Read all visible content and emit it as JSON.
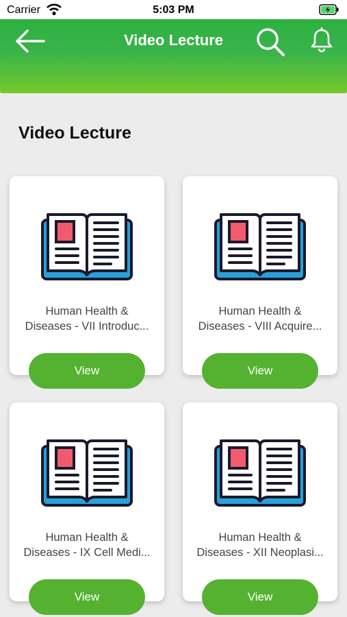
{
  "status_bar": {
    "carrier": "Carrier",
    "time": "5:03 PM"
  },
  "header": {
    "title": "Video Lecture"
  },
  "section": {
    "title": "Video Lecture"
  },
  "cards": [
    {
      "title_line1": "Human Health &",
      "title_line2": "Diseases - VII Introduc...",
      "button_label": "View"
    },
    {
      "title_line1": "Human Health &",
      "title_line2": "Diseases - VIII Acquire...",
      "button_label": "View"
    },
    {
      "title_line1": "Human Health &",
      "title_line2": "Diseases - IX Cell Medi...",
      "button_label": "View"
    },
    {
      "title_line1": "Human Health &",
      "title_line2": "Diseases - XII Neoplasi...",
      "button_label": "View"
    }
  ],
  "icons": {
    "back": "arrow-left-icon",
    "search": "search-icon",
    "notifications": "bell-icon",
    "card": "open-book-icon"
  },
  "colors": {
    "header_top": "#2eb141",
    "header_bottom": "#74c92a",
    "button": "#55b231",
    "book_cover": "#2a9fd8",
    "book_bookmark": "#f25b6e"
  }
}
